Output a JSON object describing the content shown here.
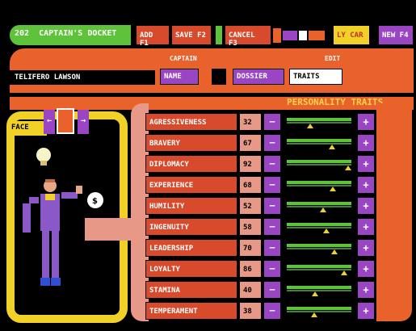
{
  "header": {
    "screen_id": "202",
    "title": "CAPTAIN'S DOCKET",
    "buttons": [
      {
        "label": "ADD F1"
      },
      {
        "label": "SAVE F2"
      },
      {
        "label": "CANCEL F3"
      },
      {
        "label": "LY CAR"
      },
      {
        "label": "NEW F4"
      }
    ]
  },
  "captain": {
    "section_label": "CAPTAIN",
    "edit_label": "EDIT",
    "name": "TELIFERO LAWSON",
    "name_btn": "NAME",
    "dossier_btn": "DOSSIER",
    "traits_btn": "TRAITS"
  },
  "face": {
    "label": "FACE",
    "prev": "←",
    "next": "→"
  },
  "traits_title": "PERSONALITY TRAITS",
  "traits": [
    {
      "label": "AGRESSIVENESS",
      "value": "32",
      "level": 0.32,
      "minus": "—",
      "plus": "+"
    },
    {
      "label": "BRAVERY",
      "value": "67",
      "level": 0.67,
      "minus": "—",
      "plus": "+"
    },
    {
      "label": "DIPLOMACY",
      "value": "92",
      "level": 0.92,
      "minus": "—",
      "plus": "+"
    },
    {
      "label": "EXPERIENCE",
      "value": "68",
      "level": 0.68,
      "minus": "—",
      "plus": "+"
    },
    {
      "label": "HUMILITY",
      "value": "52",
      "level": 0.52,
      "minus": "—",
      "plus": "+"
    },
    {
      "label": "INGENUITY",
      "value": "58",
      "level": 0.58,
      "minus": "—",
      "plus": "+"
    },
    {
      "label": "LEADERSHIP",
      "value": "70",
      "level": 0.7,
      "minus": "—",
      "plus": "+"
    },
    {
      "label": "LOYALTY",
      "value": "86",
      "level": 0.86,
      "minus": "—",
      "plus": "+"
    },
    {
      "label": "STAMINA",
      "value": "40",
      "level": 0.4,
      "minus": "—",
      "plus": "+"
    },
    {
      "label": "TEMPERAMENT",
      "value": "38",
      "level": 0.38,
      "minus": "—",
      "plus": "+"
    }
  ],
  "colors": {
    "orange": "#e9612b",
    "green": "#5ec33a",
    "purple": "#9a46c4",
    "yellow": "#f1d028",
    "pink": "#e89886"
  }
}
